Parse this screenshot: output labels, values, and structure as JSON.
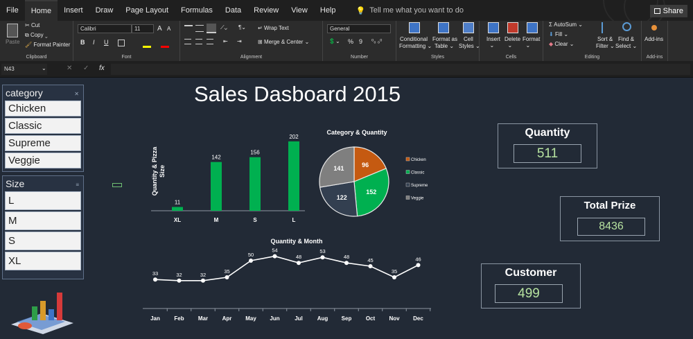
{
  "menu": {
    "tabs": [
      "File",
      "Home",
      "Insert",
      "Draw",
      "Page Layout",
      "Formulas",
      "Data",
      "Review",
      "View",
      "Help"
    ],
    "active_tab": "Home",
    "tell_me": "Tell me what you want to do",
    "share": "Share"
  },
  "ribbon": {
    "clipboard": {
      "paste": "Paste",
      "cut": "Cut",
      "copy": "Copy",
      "format_painter": "Format Painter",
      "label": "Clipboard"
    },
    "font": {
      "name": "Calibri",
      "size": "11",
      "bold": "B",
      "italic": "I",
      "underline": "U",
      "grow": "A",
      "shrink": "A",
      "label": "Font"
    },
    "alignment": {
      "wrap_text": "Wrap Text",
      "merge_center": "Merge & Center",
      "label": "Alignment"
    },
    "number": {
      "format": "General",
      "percent": "%",
      "comma": "9",
      "label": "Number"
    },
    "styles": {
      "conditional": "Conditional",
      "formatting": "Formatting",
      "format_as": "Format as",
      "table": "Table",
      "cell": "Cell",
      "styles": "Styles",
      "label": "Styles"
    },
    "cells": {
      "insert": "Insert",
      "delete": "Delete",
      "format": "Format",
      "label": "Cells"
    },
    "editing": {
      "autosum": "AutoSum",
      "fill": "Fill",
      "clear": "Clear",
      "sort": "Sort &",
      "filter": "Filter",
      "find": "Find &",
      "select": "Select",
      "label": "Editing"
    },
    "addins": {
      "addins": "Add-ins",
      "label": "Add-ins"
    }
  },
  "formula_bar": {
    "name_box": "N43",
    "fx": "fx",
    "value": ""
  },
  "dashboard": {
    "title": "Sales Dasboard 2015",
    "slicers": {
      "category": {
        "title": "category",
        "items": [
          "Chicken",
          "Classic",
          "Supreme",
          "Veggie"
        ]
      },
      "size": {
        "title": "Size",
        "items": [
          "L",
          "M",
          "S",
          "XL"
        ]
      }
    },
    "kpis": {
      "quantity": {
        "label": "Quantity",
        "value": "511"
      },
      "total_prize": {
        "label": "Total Prize",
        "value": "8436"
      },
      "customer": {
        "label": "Customer",
        "value": "499"
      }
    }
  },
  "colors": {
    "green": "#00b050",
    "orange": "#c55a11",
    "dark_slate": "#333f50",
    "gray": "#7f7f7f",
    "background": "#222a36"
  },
  "chart_data": [
    {
      "type": "bar",
      "title": "",
      "ylabel": "Quantity & Pizza Size",
      "categories": [
        "XL",
        "M",
        "S",
        "L"
      ],
      "values": [
        11,
        142,
        156,
        202
      ],
      "ylim": [
        0,
        210
      ],
      "grid": false
    },
    {
      "type": "pie",
      "title": "Category & Quantity",
      "categories": [
        "Chicken",
        "Classic",
        "Supreme",
        "Veggie"
      ],
      "values": [
        96,
        152,
        122,
        141
      ],
      "legend": "right"
    },
    {
      "type": "line",
      "title": "Quantity &  Month",
      "categories": [
        "Jan",
        "Feb",
        "Mar",
        "Apr",
        "May",
        "Jun",
        "Jul",
        "Aug",
        "Sep",
        "Oct",
        "Nov",
        "Dec"
      ],
      "values": [
        33,
        32,
        32,
        35,
        50,
        54,
        48,
        53,
        48,
        45,
        35,
        46
      ],
      "ylim": [
        0,
        60
      ],
      "grid": false
    }
  ]
}
